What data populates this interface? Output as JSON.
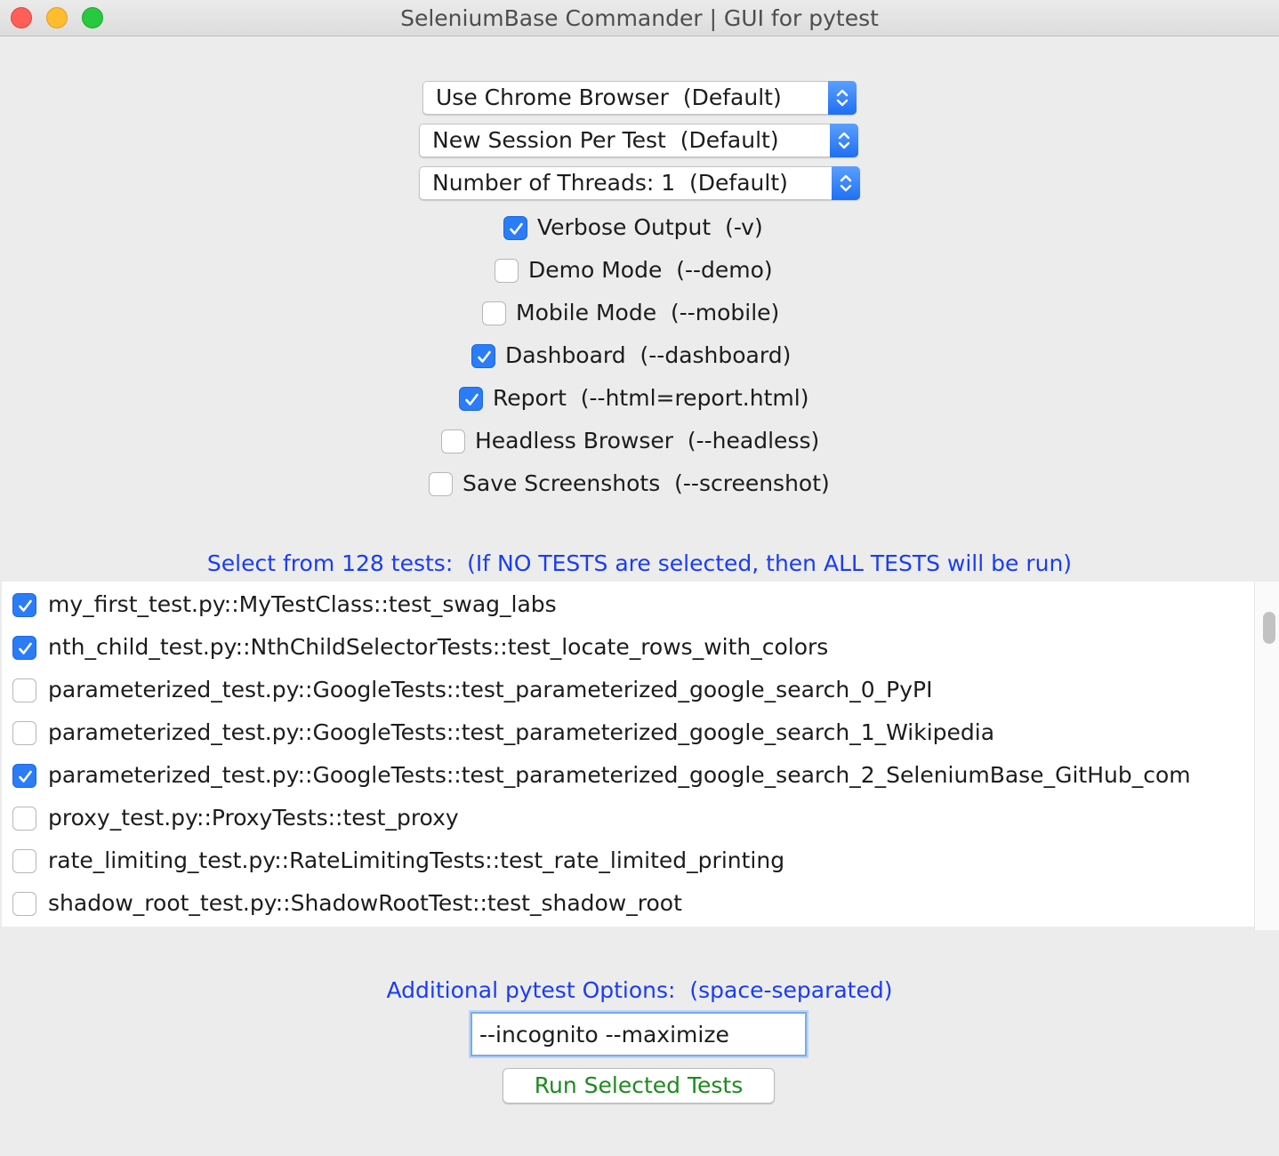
{
  "window": {
    "title": "SeleniumBase Commander | GUI for pytest"
  },
  "selects": {
    "browser": "Use Chrome Browser  (Default)",
    "session": "New Session Per Test  (Default)",
    "threads": "Number of Threads: 1  (Default)"
  },
  "options": [
    {
      "label": "Verbose Output  (-v)",
      "checked": true
    },
    {
      "label": "Demo Mode  (--demo)",
      "checked": false
    },
    {
      "label": "Mobile Mode  (--mobile)",
      "checked": false
    },
    {
      "label": "Dashboard  (--dashboard)",
      "checked": true
    },
    {
      "label": "Report  (--html=report.html)",
      "checked": true
    },
    {
      "label": "Headless Browser  (--headless)",
      "checked": false
    },
    {
      "label": "Save Screenshots  (--screenshot)",
      "checked": false
    }
  ],
  "tests_header": "Select from 128 tests:  (If NO TESTS are selected, then ALL TESTS will be run)",
  "tests": [
    {
      "label": "my_first_test.py::MyTestClass::test_swag_labs",
      "checked": true
    },
    {
      "label": "nth_child_test.py::NthChildSelectorTests::test_locate_rows_with_colors",
      "checked": true
    },
    {
      "label": "parameterized_test.py::GoogleTests::test_parameterized_google_search_0_PyPI",
      "checked": false
    },
    {
      "label": "parameterized_test.py::GoogleTests::test_parameterized_google_search_1_Wikipedia",
      "checked": false
    },
    {
      "label": "parameterized_test.py::GoogleTests::test_parameterized_google_search_2_SeleniumBase_GitHub_com",
      "checked": true
    },
    {
      "label": "proxy_test.py::ProxyTests::test_proxy",
      "checked": false
    },
    {
      "label": "rate_limiting_test.py::RateLimitingTests::test_rate_limited_printing",
      "checked": false
    },
    {
      "label": "shadow_root_test.py::ShadowRootTest::test_shadow_root",
      "checked": false
    }
  ],
  "pytest_options": {
    "label": "Additional pytest Options:  (space-separated)",
    "value": "--incognito --maximize"
  },
  "run_button": "Run Selected Tests",
  "colors": {
    "accent": "#2a7cf8",
    "section_label": "#1a3cf5",
    "run_button_text": "#1d8a1d"
  }
}
